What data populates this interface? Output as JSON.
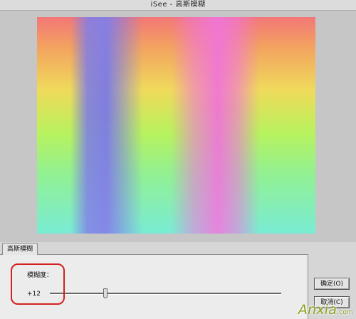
{
  "window": {
    "title": "iSee - 高斯模糊"
  },
  "tabs": [
    {
      "label": "高斯模糊"
    }
  ],
  "blur": {
    "label": "模糊度：",
    "value": "+12",
    "slider_fraction": 0.24
  },
  "buttons": {
    "ok_label": "确定(O)",
    "cancel_label": "取消(C)"
  },
  "watermark": {
    "text": "Anxia",
    "suffix": ".com"
  },
  "colors": {
    "highlight": "#d2201e",
    "watermark": "#8aa020"
  }
}
